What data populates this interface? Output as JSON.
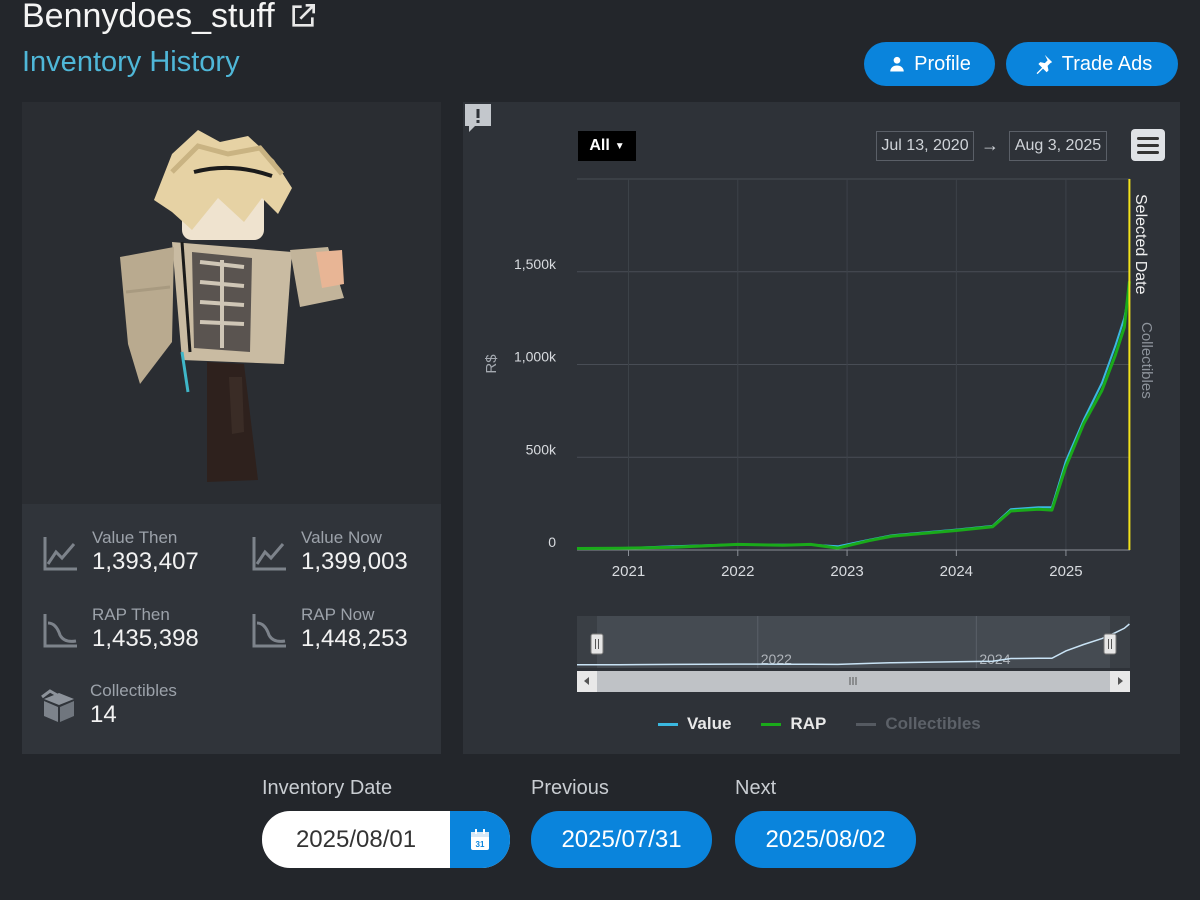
{
  "header": {
    "username": "Bennydoes_stuff",
    "subtitle": "Inventory History",
    "profile_label": "Profile",
    "trade_ads_label": "Trade Ads"
  },
  "stats": {
    "value_then_label": "Value Then",
    "value_then": "1,393,407",
    "value_now_label": "Value Now",
    "value_now": "1,399,003",
    "rap_then_label": "RAP Then",
    "rap_then": "1,435,398",
    "rap_now_label": "RAP Now",
    "rap_now": "1,448,253",
    "collectibles_label": "Collectibles",
    "collectibles": "14"
  },
  "chart_toolbar": {
    "range_label": "All",
    "from_date": "Jul 13, 2020",
    "arrow": "→",
    "to_date": "Aug 3, 2025"
  },
  "chart_data": {
    "type": "line",
    "ylabel": "R$",
    "ylim": [
      0,
      2000000
    ],
    "y_ticks": [
      "0",
      "500k",
      "1,000k",
      "1,500k"
    ],
    "x_ticks": [
      "2021",
      "2022",
      "2023",
      "2024",
      "2025"
    ],
    "navigator_ticks": [
      "2022",
      "2024"
    ],
    "plotline_label": "Selected Date",
    "plotline_date": "2025-08-01",
    "right_axis_label": "Collectibles",
    "x": [
      "2020-07-13",
      "2020-12-01",
      "2021-06-01",
      "2022-01-01",
      "2022-06-01",
      "2022-09-01",
      "2022-12-01",
      "2023-03-15",
      "2023-06-01",
      "2024-01-01",
      "2024-05-01",
      "2024-07-01",
      "2024-10-01",
      "2024-11-15",
      "2025-01-01",
      "2025-03-01",
      "2025-05-01",
      "2025-06-15",
      "2025-07-15",
      "2025-08-01"
    ],
    "series": [
      {
        "name": "Value",
        "color": "#3ab8e0",
        "values": [
          8000,
          9000,
          20000,
          30000,
          28000,
          28000,
          20000,
          55000,
          80000,
          110000,
          130000,
          220000,
          230000,
          230000,
          480000,
          700000,
          900000,
          1100000,
          1250000,
          1399003
        ]
      },
      {
        "name": "RAP",
        "color": "#1aaa1a",
        "values": [
          8000,
          9000,
          15000,
          30000,
          26000,
          30000,
          10000,
          50000,
          75000,
          105000,
          125000,
          210000,
          220000,
          215000,
          450000,
          680000,
          860000,
          1050000,
          1200000,
          1448253
        ]
      },
      {
        "name": "Collectibles",
        "color": "#555a61",
        "values": []
      }
    ]
  },
  "date_nav": {
    "inventory_date_label": "Inventory Date",
    "inventory_date": "2025/08/01",
    "calendar_day": "31",
    "previous_label": "Previous",
    "previous_date": "2025/07/31",
    "next_label": "Next",
    "next_date": "2025/08/02"
  }
}
